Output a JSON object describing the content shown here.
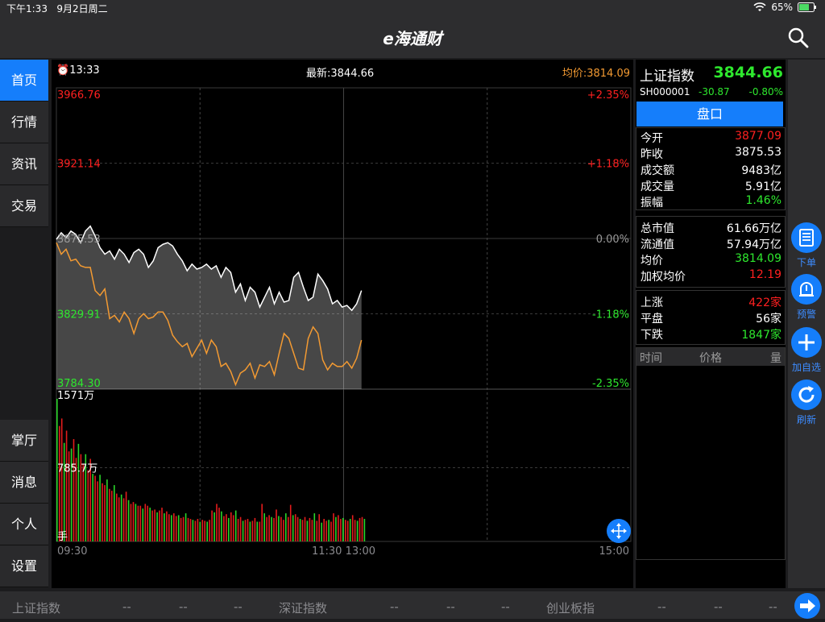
{
  "status": {
    "time": "下午1:33",
    "date": "9月2日周二",
    "battery": "65%"
  },
  "app": {
    "title": "e海通财"
  },
  "sidebar": {
    "items": [
      {
        "label": "首页",
        "active": true
      },
      {
        "label": "行情"
      },
      {
        "label": "资讯"
      },
      {
        "label": "交易"
      }
    ],
    "bottom_items": [
      {
        "label": "掌厅"
      },
      {
        "label": "消息"
      },
      {
        "label": "个人"
      },
      {
        "label": "设置"
      }
    ]
  },
  "chart_header": {
    "time": "13:33",
    "latest": "最新:3844.66",
    "avg": "均价:3814.09"
  },
  "chart_data": {
    "type": "line",
    "x_ticks": [
      "09:30",
      "11:30 13:00",
      "15:00"
    ],
    "ylim": [
      3784.3,
      3966.76
    ],
    "y_left_ticks": [
      "3966.76",
      "3921.14",
      "3875.53",
      "3829.91",
      "3784.30"
    ],
    "y_right_ticks": [
      "+2.35%",
      "+1.18%",
      "0.00%",
      "-1.18%",
      "-2.35%"
    ],
    "series": [
      {
        "color": "#ffffff",
        "values": [
          3875,
          3879,
          3876,
          3880,
          3878,
          3873,
          3880,
          3883,
          3877,
          3870,
          3866,
          3868,
          3863,
          3869,
          3866,
          3861,
          3867,
          3869,
          3866,
          3858,
          3862,
          3870,
          3872,
          3873,
          3871,
          3866,
          3862,
          3856,
          3860,
          3857,
          3858,
          3860,
          3857,
          3859,
          3852,
          3858,
          3855,
          3843,
          3848,
          3838,
          3846,
          3843,
          3834,
          3840,
          3846,
          3836,
          3843,
          3837,
          3838,
          3852,
          3855,
          3846,
          3838,
          3840,
          3854,
          3850,
          3845,
          3836,
          3838,
          3834,
          3835,
          3832,
          3836,
          3844
        ]
      },
      {
        "color": "#f39a32",
        "values": [
          3873,
          3866,
          3869,
          3862,
          3863,
          3859,
          3858,
          3858,
          3844,
          3841,
          3845,
          3827,
          3829,
          3825,
          3831,
          3827,
          3818,
          3827,
          3830,
          3827,
          3828,
          3831,
          3831,
          3826,
          3817,
          3813,
          3810,
          3812,
          3804,
          3809,
          3814,
          3806,
          3814,
          3810,
          3798,
          3800,
          3795,
          3787,
          3794,
          3796,
          3800,
          3791,
          3799,
          3798,
          3801,
          3793,
          3806,
          3818,
          3815,
          3806,
          3797,
          3796,
          3815,
          3822,
          3818,
          3802,
          3796,
          3800,
          3798,
          3798,
          3801,
          3797,
          3803,
          3814
        ]
      }
    ],
    "volume": {
      "labels": [
        "1571万",
        "785.7万",
        "手"
      ],
      "max": 1571,
      "values": [
        1520,
        1230,
        1310,
        1050,
        1180,
        960,
        990,
        1090,
        890,
        1040,
        930,
        830,
        930,
        760,
        880,
        720,
        700,
        640,
        710,
        620,
        600,
        660,
        560,
        540,
        600,
        510,
        470,
        500,
        460,
        530,
        440,
        400,
        420,
        400,
        380,
        380,
        350,
        400,
        380,
        360,
        330,
        340,
        310,
        330,
        360,
        300,
        320,
        290,
        280,
        300,
        270,
        280,
        250,
        260,
        300,
        250,
        240,
        230,
        220,
        240,
        210,
        230,
        220,
        210,
        230,
        330,
        310,
        400,
        360,
        320,
        270,
        290,
        250,
        310,
        280,
        330,
        240,
        260,
        220,
        230,
        240,
        210,
        220,
        250,
        210,
        210,
        400,
        300,
        260,
        280,
        260,
        250,
        340,
        270,
        260,
        230,
        300,
        260,
        390,
        280,
        290,
        260,
        240,
        230,
        260,
        220,
        250,
        230,
        300,
        220,
        290,
        200,
        240,
        220,
        230,
        210,
        300,
        260,
        280,
        240,
        250,
        230,
        220,
        240,
        280,
        230,
        220,
        250,
        260,
        240
      ]
    }
  },
  "quote": {
    "name": "上证指数",
    "price": "3844.66",
    "code": "SH000001",
    "change": "-30.87",
    "pct": "-0.80%",
    "section": "盘口",
    "rows_a": [
      {
        "k": "今开",
        "v": "3877.09",
        "c": "red"
      },
      {
        "k": "昨收",
        "v": "3875.53",
        "c": "white"
      },
      {
        "k": "成交额",
        "v": "9483亿",
        "c": "white"
      },
      {
        "k": "成交量",
        "v": "5.91亿",
        "c": "white"
      },
      {
        "k": "振幅",
        "v": "1.46%",
        "c": "green"
      }
    ],
    "rows_b": [
      {
        "k": "总市值",
        "v": "61.66万亿",
        "c": "white"
      },
      {
        "k": "流通值",
        "v": "57.94万亿",
        "c": "white"
      },
      {
        "k": "均价",
        "v": "3814.09",
        "c": "green"
      },
      {
        "k": "加权均价",
        "v": "12.19",
        "c": "red"
      }
    ],
    "rows_c": [
      {
        "k": "上涨",
        "v": "422家",
        "c": "red"
      },
      {
        "k": "平盘",
        "v": "56家",
        "c": "white"
      },
      {
        "k": "下跌",
        "v": "1847家",
        "c": "green"
      }
    ],
    "trade_headers": [
      "时间",
      "价格",
      "量"
    ]
  },
  "actions": [
    {
      "label": "下单",
      "icon": "order-icon"
    },
    {
      "label": "预警",
      "icon": "bell-icon"
    },
    {
      "label": "加自选",
      "icon": "plus-icon"
    },
    {
      "label": "刷新",
      "icon": "refresh-icon"
    }
  ],
  "ticker": [
    {
      "name": "上证指数",
      "a": "--",
      "b": "--",
      "c": "--"
    },
    {
      "name": "深证指数",
      "a": "--",
      "b": "--",
      "c": "--"
    },
    {
      "name": "创业板指",
      "a": "--",
      "b": "--",
      "c": "--"
    }
  ]
}
